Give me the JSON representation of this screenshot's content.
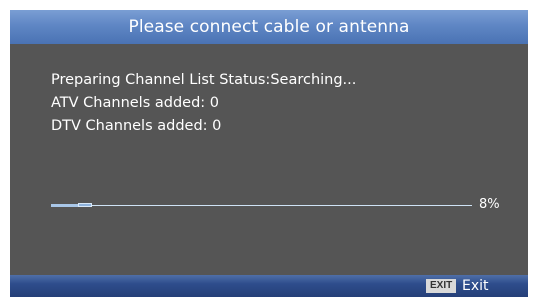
{
  "title_bar": {
    "text": "Please connect cable or antenna"
  },
  "status": {
    "line1": "Preparing Channel List Status:Searching...",
    "line2": "ATV Channels added: 0",
    "line3": "DTV Channels added: 0"
  },
  "progress": {
    "percent": 8,
    "label": "8%"
  },
  "footer": {
    "exit_key": "EXIT",
    "exit_label": "Exit"
  },
  "colors": {
    "panel_background": "#555555",
    "title_bar": "#5f86c4",
    "footer_bar": "#2e4d8c",
    "progress_track": "#cfe3f5"
  }
}
